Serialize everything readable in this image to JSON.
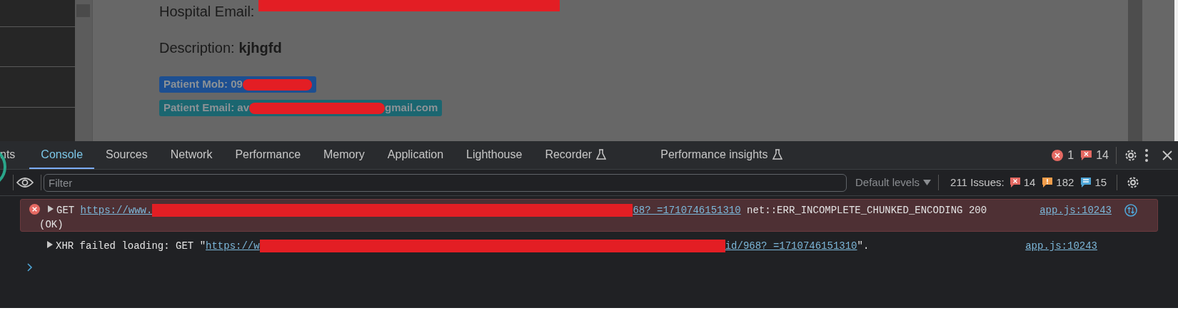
{
  "page": {
    "fields": [
      {
        "label": "Hospital Email:",
        "value_redacted": true
      },
      {
        "label": "Description:",
        "value": "kjhgfd"
      }
    ],
    "badges": [
      {
        "color": "#1d4f91",
        "segments": [
          {
            "text": "Patient Mob: 09"
          },
          {
            "kind": "redacted"
          }
        ]
      },
      {
        "color": "#1b6670",
        "segments": [
          {
            "text": "Patient Email: av"
          },
          {
            "kind": "redacted"
          },
          {
            "text": "gmail.com"
          }
        ]
      }
    ]
  },
  "devtools": {
    "tabs": [
      {
        "label": "nts",
        "selected": false
      },
      {
        "label": "Console",
        "selected": true
      },
      {
        "label": "Sources",
        "selected": false
      },
      {
        "label": "Network",
        "selected": false
      },
      {
        "label": "Performance",
        "selected": false
      },
      {
        "label": "Memory",
        "selected": false
      },
      {
        "label": "Application",
        "selected": false
      },
      {
        "label": "Lighthouse",
        "selected": false
      },
      {
        "label": "Recorder",
        "selected": false,
        "experimental": true
      },
      {
        "label": "Performance insights",
        "selected": false,
        "experimental": true
      }
    ],
    "error_count": "1",
    "issue_count": "14",
    "filter": {
      "placeholder": "Filter"
    },
    "levels": "Default levels",
    "issues_label": "211 Issues:",
    "issues": [
      {
        "kind": "error",
        "count": "14"
      },
      {
        "kind": "warning",
        "count": "182"
      },
      {
        "kind": "info",
        "count": "15"
      }
    ],
    "messages": [
      {
        "kind": "error",
        "segments": [
          {
            "text": "GET "
          },
          {
            "kind": "link",
            "text": "https://www."
          },
          {
            "kind": "redacted"
          },
          {
            "kind": "link",
            "text": "68?_=1710746151310"
          },
          {
            "text": " net::ERR_INCOMPLETE_CHUNKED_ENCODING 200"
          },
          {
            "kind": "break"
          },
          {
            "text": "(OK)"
          }
        ],
        "source": "app.js:10243"
      },
      {
        "kind": "info",
        "segments": [
          {
            "text": "XHR failed loading: GET \""
          },
          {
            "kind": "link",
            "text": "https://w"
          },
          {
            "kind": "redacted"
          },
          {
            "kind": "link",
            "text": "id/968?_=1710746151310"
          },
          {
            "text": "\"."
          }
        ],
        "source": "app.js:10243"
      }
    ]
  }
}
